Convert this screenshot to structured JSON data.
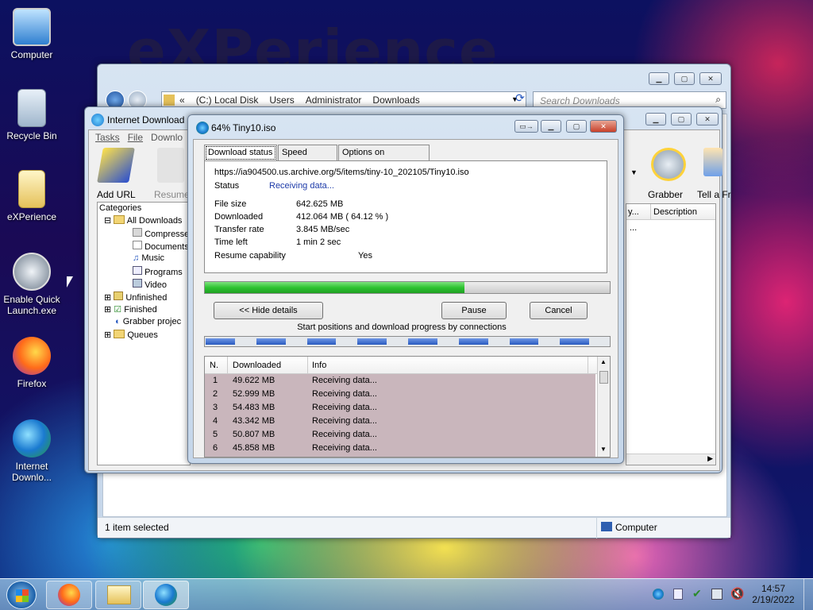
{
  "desktop": {
    "watermark": "eXPerience",
    "icons": [
      {
        "label": "Computer"
      },
      {
        "label": "Recycle Bin"
      },
      {
        "label": "eXPerience"
      },
      {
        "label": "Enable Quick Launch.exe"
      },
      {
        "label": "Firefox"
      },
      {
        "label": "Internet Downlo..."
      }
    ]
  },
  "explorer": {
    "breadcrumb": [
      "«",
      "(C:) Local Disk",
      "Users",
      "Administrator",
      "Downloads"
    ],
    "search_placeholder": "Search Downloads",
    "status_left": "1 item selected",
    "status_right": "Computer"
  },
  "idm_main": {
    "title": "Internet Download",
    "menu": [
      "Tasks",
      "File",
      "Downlo"
    ],
    "toolbar": {
      "add_url": "Add URL",
      "resume": "Resume",
      "grabber": "Grabber",
      "tell_friend": "Tell a Fr"
    },
    "categories_header": "Categories",
    "tree": [
      "All Downloads",
      "Compresse",
      "Documents",
      "Music",
      "Programs",
      "Video",
      "Unfinished",
      "Finished",
      "Grabber projec",
      "Queues"
    ],
    "col_partial": "y...",
    "col_description": "Description",
    "cell_partial": "..."
  },
  "progress_dialog": {
    "title": "64% Tiny10.iso",
    "tabs": [
      "Download status",
      "Speed Limiter",
      "Options on completion"
    ],
    "url": "https://ia904500.us.archive.org/5/items/tiny-10_202105/Tiny10.iso",
    "status_label": "Status",
    "status_value": "Receiving data...",
    "file_size_label": "File size",
    "file_size_value": "642.625  MB",
    "downloaded_label": "Downloaded",
    "downloaded_value": "412.064  MB  ( 64.12 % )",
    "rate_label": "Transfer rate",
    "rate_value": "3.845  MB/sec",
    "time_label": "Time left",
    "time_value": "1 min 2 sec",
    "resume_label": "Resume capability",
    "resume_value": "Yes",
    "progress": 0.6412,
    "buttons": {
      "hide": "<< Hide details",
      "pause": "Pause",
      "cancel": "Cancel"
    },
    "connections_caption": "Start positions and download progress by connections",
    "table_headers": [
      "N.",
      "Downloaded",
      "Info"
    ],
    "connections": [
      {
        "n": "1",
        "downloaded": "49.622  MB",
        "info": "Receiving data..."
      },
      {
        "n": "2",
        "downloaded": "52.999  MB",
        "info": "Receiving data..."
      },
      {
        "n": "3",
        "downloaded": "54.483  MB",
        "info": "Receiving data..."
      },
      {
        "n": "4",
        "downloaded": "43.342  MB",
        "info": "Receiving data..."
      },
      {
        "n": "5",
        "downloaded": "50.807  MB",
        "info": "Receiving data..."
      },
      {
        "n": "6",
        "downloaded": "45.858  MB",
        "info": "Receiving data..."
      }
    ]
  },
  "taskbar": {
    "time": "14:57",
    "date": "2/19/2022"
  },
  "colors": {
    "progress_green": "#2ec431",
    "connection_blue": "#2a5bc0",
    "table_row_bg": "#c9b6bc"
  }
}
